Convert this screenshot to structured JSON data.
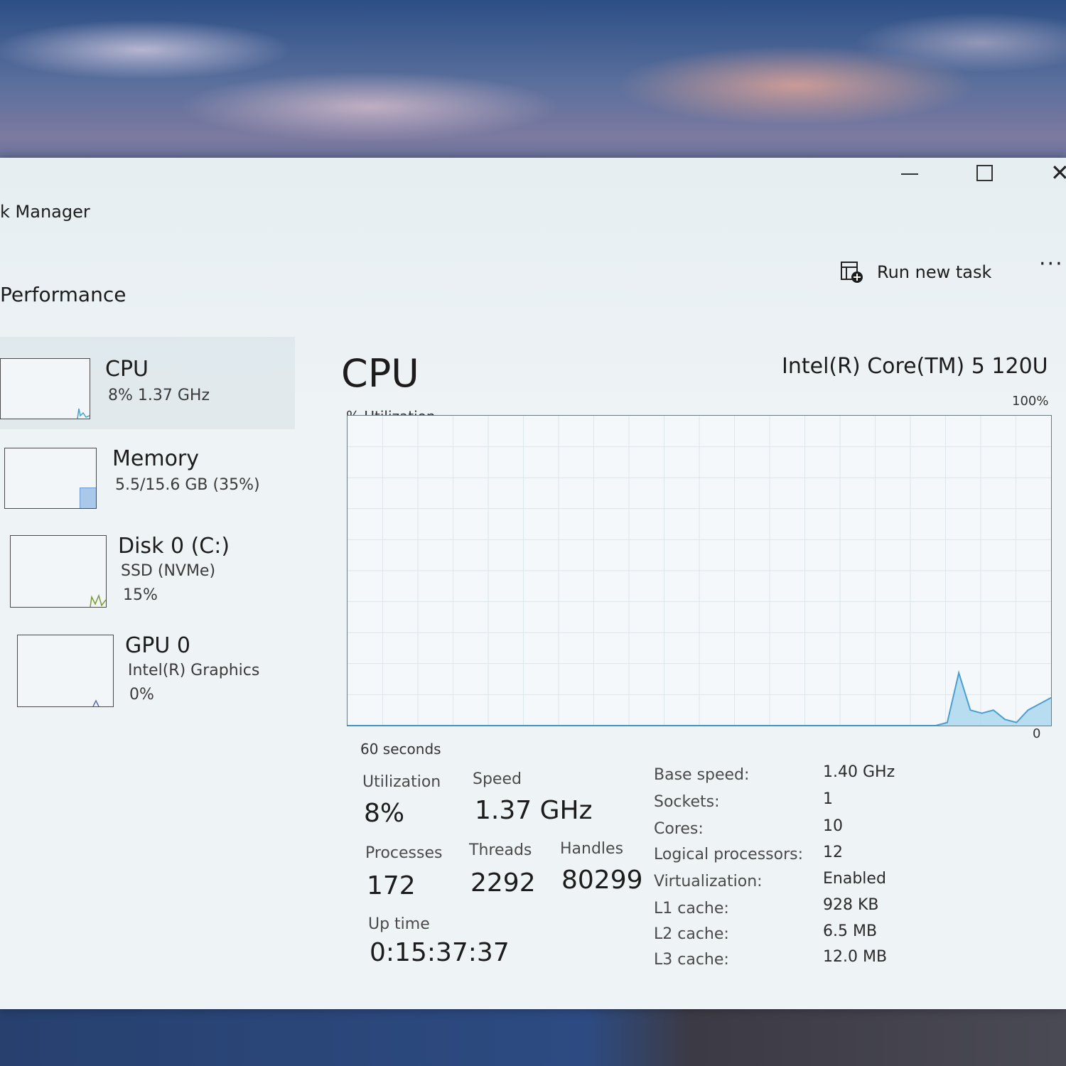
{
  "window": {
    "title": "k Manager",
    "controls": {
      "minimize_icon": "minimize-icon",
      "maximize_icon": "maximize-icon",
      "close_icon": "close-icon"
    }
  },
  "header": {
    "section_title": "Performance",
    "run_new_task": "Run new task",
    "more": "···"
  },
  "sidebar": {
    "items": [
      {
        "name": "CPU",
        "sub1": "8%  1.37 GHz",
        "sub2": ""
      },
      {
        "name": "Memory",
        "sub1": "5.5/15.6 GB (35%)",
        "sub2": ""
      },
      {
        "name": "Disk 0 (C:)",
        "sub1": "SSD (NVMe)",
        "sub2": "15%"
      },
      {
        "name": "GPU 0",
        "sub1": "Intel(R) Graphics",
        "sub2": "0%"
      }
    ]
  },
  "main": {
    "title": "CPU",
    "model": "Intel(R) Core(TM) 5 120U",
    "util_label": "% Utilization",
    "max_label": "100%",
    "time_label": "60 seconds",
    "zero_label": "0"
  },
  "stats": {
    "utilization_label": "Utilization",
    "utilization": "8%",
    "speed_label": "Speed",
    "speed": "1.37 GHz",
    "processes_label": "Processes",
    "processes": "172",
    "threads_label": "Threads",
    "threads": "2292",
    "handles_label": "Handles",
    "handles": "80299",
    "uptime_label": "Up time",
    "uptime": "0:15:37:37"
  },
  "info": [
    {
      "label": "Base speed:",
      "value": "1.40 GHz"
    },
    {
      "label": "Sockets:",
      "value": "1"
    },
    {
      "label": "Cores:",
      "value": "10"
    },
    {
      "label": "Logical processors:",
      "value": "12"
    },
    {
      "label": "Virtualization:",
      "value": "Enabled"
    },
    {
      "label": "L1 cache:",
      "value": "928 KB"
    },
    {
      "label": "L2 cache:",
      "value": "6.5 MB"
    },
    {
      "label": "L3 cache:",
      "value": "12.0 MB"
    }
  ],
  "colors": {
    "graph_line": "#4a9fcf",
    "graph_fill": "#a9d6ee",
    "memory_accent": "#8cb4e0",
    "disk_accent": "#7a9a3a",
    "gpu_accent": "#5a6ab0"
  },
  "cpu_history": [
    0,
    0,
    0,
    0,
    0,
    0,
    0,
    0,
    0,
    0,
    0,
    0,
    0,
    0,
    0,
    0,
    0,
    0,
    0,
    0,
    0,
    0,
    0,
    0,
    0,
    0,
    0,
    0,
    0,
    0,
    0,
    0,
    0,
    0,
    0,
    0,
    0,
    0,
    0,
    0,
    0,
    0,
    0,
    0,
    0,
    0,
    0,
    0,
    0,
    0,
    0,
    0,
    1,
    17,
    5,
    4,
    5,
    2,
    1,
    5,
    7,
    9
  ]
}
